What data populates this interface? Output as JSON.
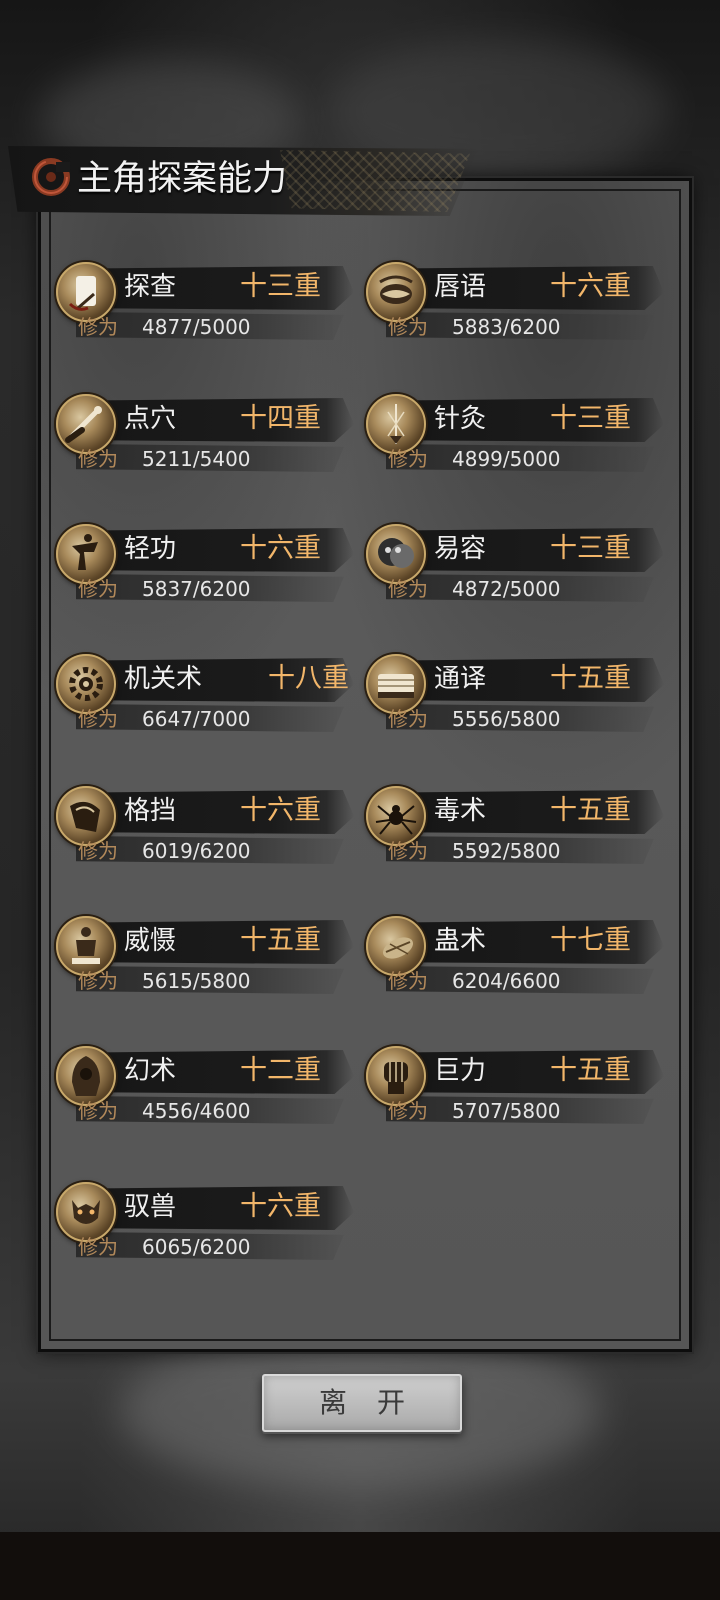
{
  "header": {
    "title": "主角探案能力"
  },
  "xp_label": "修为",
  "abilities": [
    {
      "name": "探查",
      "level": "十三重",
      "xp": "4877/5000",
      "icon": "scroll-icon"
    },
    {
      "name": "唇语",
      "level": "十六重",
      "xp": "5883/6200",
      "icon": "mouth-icon"
    },
    {
      "name": "点穴",
      "level": "十四重",
      "xp": "5211/5400",
      "icon": "finger-strike-icon"
    },
    {
      "name": "针灸",
      "level": "十三重",
      "xp": "4899/5000",
      "icon": "needle-icon"
    },
    {
      "name": "轻功",
      "level": "十六重",
      "xp": "5837/6200",
      "icon": "leaping-figure-icon"
    },
    {
      "name": "易容",
      "level": "十三重",
      "xp": "4872/5000",
      "icon": "mask-icon"
    },
    {
      "name": "机关术",
      "level": "十八重",
      "xp": "6647/7000",
      "icon": "gear-icon"
    },
    {
      "name": "通译",
      "level": "十五重",
      "xp": "5556/5800",
      "icon": "book-icon"
    },
    {
      "name": "格挡",
      "level": "十六重",
      "xp": "6019/6200",
      "icon": "shield-arm-icon"
    },
    {
      "name": "毒术",
      "level": "十五重",
      "xp": "5592/5800",
      "icon": "spider-icon"
    },
    {
      "name": "威慑",
      "level": "十五重",
      "xp": "5615/5800",
      "icon": "warrior-icon"
    },
    {
      "name": "蛊术",
      "level": "十七重",
      "xp": "6204/6600",
      "icon": "bug-icon"
    },
    {
      "name": "幻术",
      "level": "十二重",
      "xp": "4556/4600",
      "icon": "hooded-figure-icon"
    },
    {
      "name": "巨力",
      "level": "十五重",
      "xp": "5707/5800",
      "icon": "fist-icon"
    },
    {
      "name": "驭兽",
      "level": "十六重",
      "xp": "6065/6200",
      "icon": "beast-icon"
    }
  ],
  "footer": {
    "leave_label": "离开"
  },
  "colors": {
    "level_text": "#f2b66a",
    "xp_label": "#b2895a",
    "panel": "#545454"
  }
}
